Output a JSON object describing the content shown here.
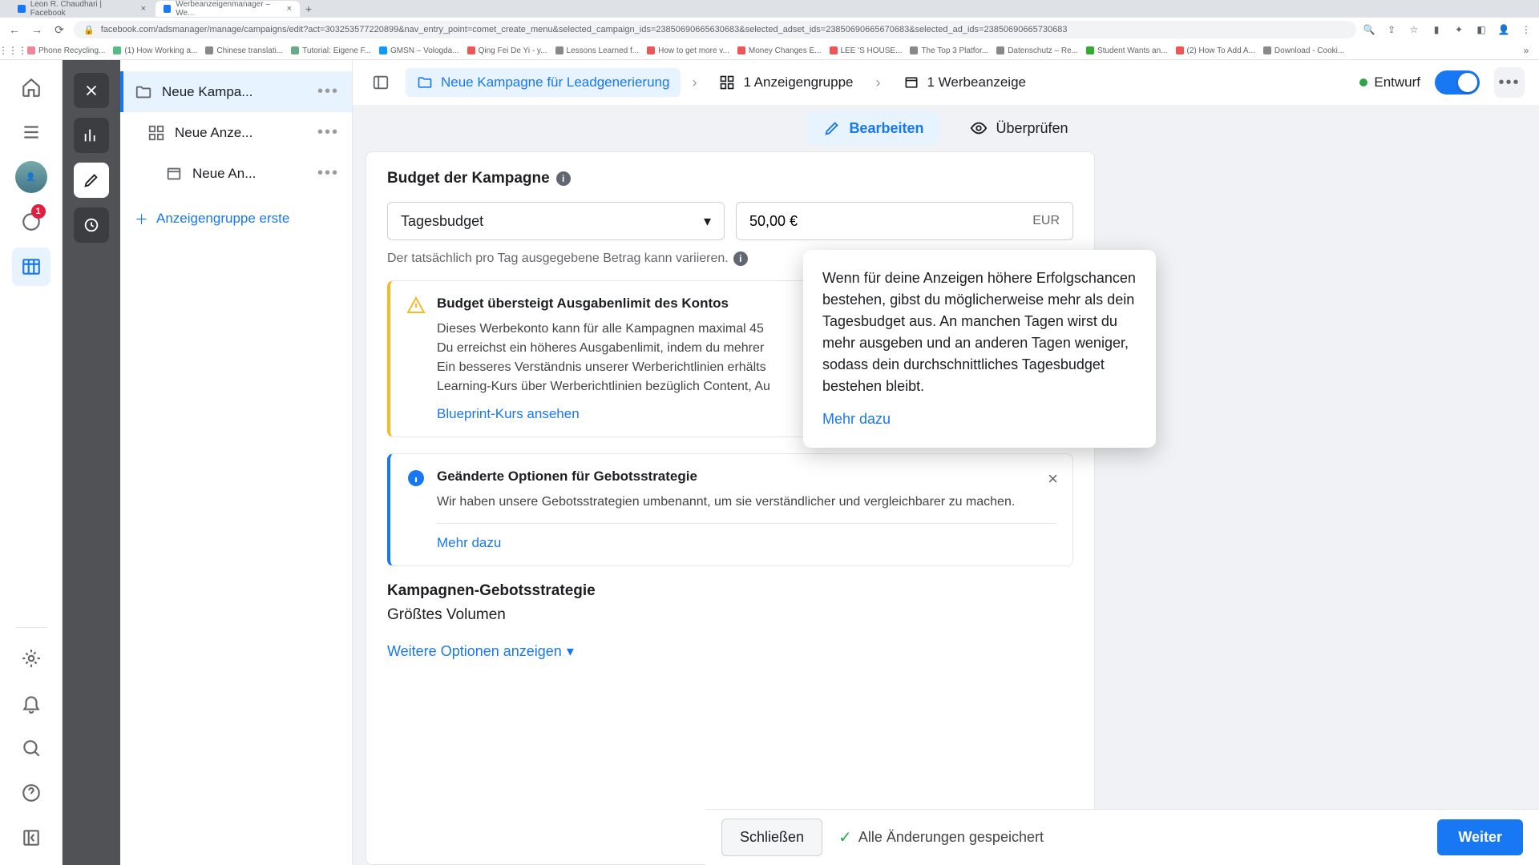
{
  "browser": {
    "tabs": [
      {
        "title": "Leon R. Chaudhari | Facebook"
      },
      {
        "title": "Werbeanzeigenmanager – We..."
      }
    ],
    "url": "facebook.com/adsmanager/manage/campaigns/edit?act=303253577220899&nav_entry_point=comet_create_menu&selected_campaign_ids=23850690665630683&selected_adset_ids=23850690665670683&selected_ad_ids=23850690665730683",
    "bookmarks": [
      "Apps",
      "Phone Recycling...",
      "(1) How Working a...",
      "Chinese translati...",
      "Tutorial: Eigene F...",
      "GMSN – Vologda...",
      "Qing Fei De Yi - y...",
      "Lessons Learned f...",
      "How to get more v...",
      "Money Changes E...",
      "LEE 'S HOUSE...",
      "The Top 3 Platfor...",
      "Datenschutz – Re...",
      "Student Wants an...",
      "(2) How To Add A...",
      "Download - Cooki..."
    ]
  },
  "far_left_badge": "1",
  "tree": {
    "campaign": "Neue Kampa...",
    "adset": "Neue Anze...",
    "ad": "Neue An...",
    "add": "Anzeigengruppe erste"
  },
  "breadcrumb": {
    "campaign": "Neue Kampagne für Leadgenerierung",
    "adset": "1 Anzeigengruppe",
    "ad": "1 Werbeanzeige",
    "status": "Entwurf"
  },
  "tabs": {
    "edit": "Bearbeiten",
    "review": "Überprüfen"
  },
  "budget": {
    "title": "Budget der Kampagne",
    "type_label": "Tagesbudget",
    "amount": "50,00 €",
    "currency": "EUR",
    "helper": "Der tatsächlich pro Tag ausgegebene Betrag kann variieren."
  },
  "alerts": {
    "warning": {
      "title": "Budget übersteigt Ausgabenlimit des Kontos",
      "body": "Dieses Werbekonto kann für alle Kampagnen maximal 45\nDu erreichst ein höheres Ausgabenlimit, indem du mehrer\nEin besseres Verständnis unserer Werberichtlinien erhälts\nLearning-Kurs über Werberichtlinien bezüglich Content, Au",
      "link": "Blueprint-Kurs ansehen"
    },
    "info": {
      "title": "Geänderte Optionen für Gebotsstrategie",
      "body": "Wir haben unsere Gebotsstrategien umbenannt, um sie verständlicher und vergleichbarer zu machen.",
      "link": "Mehr dazu"
    }
  },
  "bid": {
    "title": "Kampagnen-Gebotsstrategie",
    "value": "Größtes Volumen",
    "more": "Weitere Optionen anzeigen"
  },
  "footer": {
    "close": "Schließen",
    "saved": "Alle Änderungen gespeichert",
    "next": "Weiter"
  },
  "popover": {
    "body": "Wenn für deine Anzeigen höhere Erfolgschancen bestehen, gibst du möglicherweise mehr als dein Tagesbudget aus. An manchen Tagen wirst du mehr ausgeben und an anderen Tagen weniger, sodass dein durchschnittliches Tagesbudget bestehen bleibt.",
    "link": "Mehr dazu"
  }
}
